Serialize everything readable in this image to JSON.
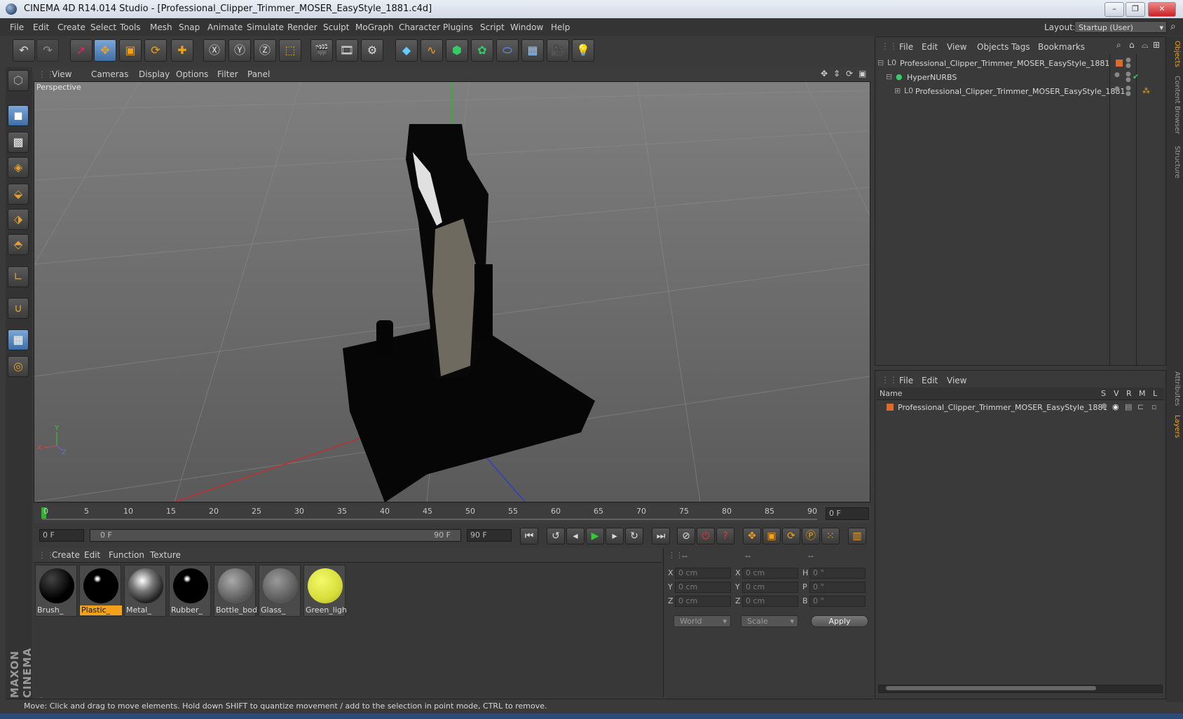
{
  "window": {
    "title": "CINEMA 4D R14.014 Studio - [Professional_Clipper_Trimmer_MOSER_EasyStyle_1881.c4d]",
    "btn_min": "–",
    "btn_max": "❐",
    "btn_close": "✕"
  },
  "menu": [
    "File",
    "Edit",
    "Create",
    "Select",
    "Tools",
    "Mesh",
    "Snap",
    "Animate",
    "Simulate",
    "Render",
    "Sculpt",
    "MoGraph",
    "Character",
    "Plugins",
    "Script",
    "Window",
    "Help"
  ],
  "layout": {
    "label": "Layout:",
    "value": "Startup (User)"
  },
  "viewport": {
    "menu": [
      "View",
      "Cameras",
      "Display",
      "Options",
      "Filter",
      "Panel"
    ],
    "label": "Perspective",
    "axis_y": "Y",
    "axis_x": "X",
    "axis_z": "Z"
  },
  "timeline": {
    "ticks": [
      "0",
      "5",
      "10",
      "15",
      "20",
      "25",
      "30",
      "35",
      "40",
      "45",
      "50",
      "55",
      "60",
      "65",
      "70",
      "75",
      "80",
      "85",
      "90"
    ],
    "current_frame": "0 F",
    "start_field": "0 F",
    "range_start": "0 F",
    "range_end": "90 F",
    "end_field": "90 F"
  },
  "materials": {
    "menu": [
      "Create",
      "Edit",
      "Function",
      "Texture"
    ],
    "items": [
      {
        "name": "Brush_",
        "color": "#050505"
      },
      {
        "name": "Plastic_",
        "color": "#050505"
      },
      {
        "name": "Metal_",
        "color": "#777777"
      },
      {
        "name": "Rubber_",
        "color": "#050505"
      },
      {
        "name": "Bottle_bod",
        "color": "#777777"
      },
      {
        "name": "Glass_",
        "color": "#666666"
      },
      {
        "name": "Green_ligh",
        "color": "#d6de3a"
      }
    ]
  },
  "coordinates": {
    "headers": [
      "--",
      "--",
      "--"
    ],
    "rows": [
      {
        "l1": "X",
        "v1": "0 cm",
        "l2": "X",
        "v2": "0 cm",
        "l3": "H",
        "v3": "0 °"
      },
      {
        "l1": "Y",
        "v1": "0 cm",
        "l2": "Y",
        "v2": "0 cm",
        "l3": "P",
        "v3": "0 °"
      },
      {
        "l1": "Z",
        "v1": "0 cm",
        "l2": "Z",
        "v2": "0 cm",
        "l3": "B",
        "v3": "0 °"
      }
    ],
    "world": "World",
    "scale": "Scale",
    "apply": "Apply"
  },
  "status": "Move: Click and drag to move elements. Hold down SHIFT to quantize movement / add to the selection in point mode, CTRL to remove.",
  "objects_panel": {
    "menu": [
      "File",
      "Edit",
      "View",
      "Objects",
      "Tags",
      "Bookmarks"
    ],
    "tree": [
      {
        "name": "Professional_Clipper_Trimmer_MOSER_EasyStyle_1881",
        "indent": 0,
        "icon": "L0"
      },
      {
        "name": "HyperNURBS",
        "indent": 1,
        "icon": "●"
      },
      {
        "name": "Professional_Clipper_Trimmer_MOSER_EasyStyle_1881",
        "indent": 2,
        "icon": "L0"
      }
    ]
  },
  "layers_panel": {
    "menu": [
      "File",
      "Edit",
      "View"
    ],
    "columns": [
      "Name",
      "S",
      "V",
      "R",
      "M",
      "L"
    ],
    "rows": [
      {
        "name": "Professional_Clipper_Trimmer_MOSER_EasyStyle_1881",
        "color": "#e06a2a"
      }
    ]
  },
  "side_tabs": [
    "Objects",
    "Content Browser",
    "Structure",
    "Attributes",
    "Layers"
  ],
  "brand": "MAXON CINEMA 4D",
  "colors": {
    "accent": "#f3a11a",
    "selected_tool": "#4f7fb8"
  }
}
